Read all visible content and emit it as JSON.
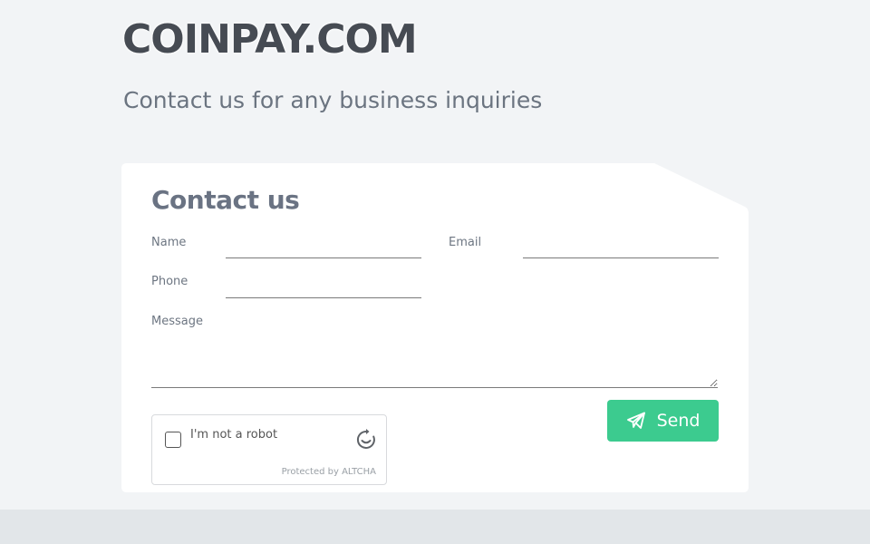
{
  "brand": "COINPAY.COM",
  "tagline": "Contact us for any business inquiries",
  "form": {
    "title": "Contact us",
    "name_label": "Name",
    "email_label": "Email",
    "phone_label": "Phone",
    "message_label": "Message",
    "name_value": "",
    "email_value": "",
    "phone_value": "",
    "message_value": "",
    "send_label": "Send"
  },
  "captcha": {
    "label": "I'm not a robot",
    "protected_by": "Protected by ALTCHA",
    "checked": false
  },
  "colors": {
    "page_bg": "#f2f4f6",
    "brand_text": "#464b53",
    "send_button": "#3ccb8f",
    "footer_band": "#e2e6e9"
  },
  "icons": {
    "send": "paper-plane-icon",
    "captcha": "altcha-spinner-icon"
  }
}
